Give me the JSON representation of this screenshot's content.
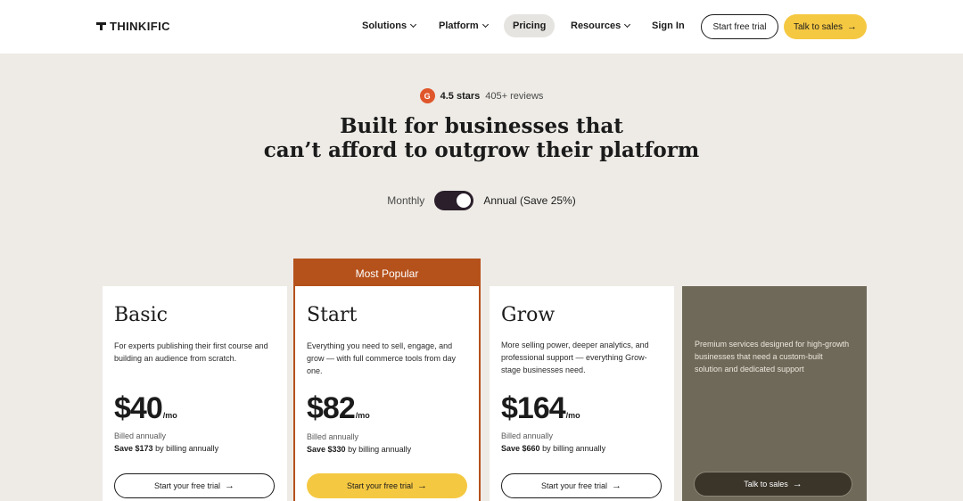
{
  "header": {
    "logo": "THINKIFIC",
    "nav": [
      {
        "label": "Solutions",
        "dropdown": true
      },
      {
        "label": "Platform",
        "dropdown": true
      },
      {
        "label": "Pricing",
        "dropdown": false,
        "active": true
      },
      {
        "label": "Resources",
        "dropdown": true
      },
      {
        "label": "Sign In",
        "dropdown": false
      }
    ],
    "start_trial": "Start free trial",
    "talk_to_sales": "Talk to sales"
  },
  "hero": {
    "g2_icon": "G",
    "rating_stars": "4.5 stars",
    "rating_reviews": "405+ reviews",
    "title_line1": "Built for businesses that",
    "title_line2": "can’t afford to outgrow their platform",
    "toggle_monthly": "Monthly",
    "toggle_annual": "Annual (Save 25%)",
    "toggle_state": "annual"
  },
  "plans": [
    {
      "name": "Basic",
      "description": "For experts publishing their first course and building an audience from scratch.",
      "price": "$40",
      "period": "/mo",
      "billed": "Billed annually",
      "save_amount": "Save $173",
      "save_text": "by billing annually",
      "cta": "Start your free trial"
    },
    {
      "badge": "Most Popular",
      "name": "Start",
      "description": "Everything you need to sell, engage, and grow — with full commerce tools from day one.",
      "price": "$82",
      "period": "/mo",
      "billed": "Billed annually",
      "save_amount": "Save $330",
      "save_text": "by billing annually",
      "cta": "Start your free trial"
    },
    {
      "name": "Grow",
      "description": "More selling power, deeper analytics, and professional support — everything Grow-stage businesses need.",
      "price": "$164",
      "period": "/mo",
      "billed": "Billed annually",
      "save_amount": "Save $660",
      "save_text": "by billing annually",
      "cta": "Start your free trial"
    },
    {
      "description": "Premium services designed for high-growth businesses that need a custom-built solution and dedicated support",
      "cta": "Talk to sales"
    }
  ],
  "icons": {
    "arrow": "→",
    "chevron": "chevron-down-icon"
  },
  "colors": {
    "accent_yellow": "#f5c842",
    "popular_orange": "#b5511b",
    "enterprise_bg": "#6f6959",
    "page_bg": "#eeebe6"
  }
}
